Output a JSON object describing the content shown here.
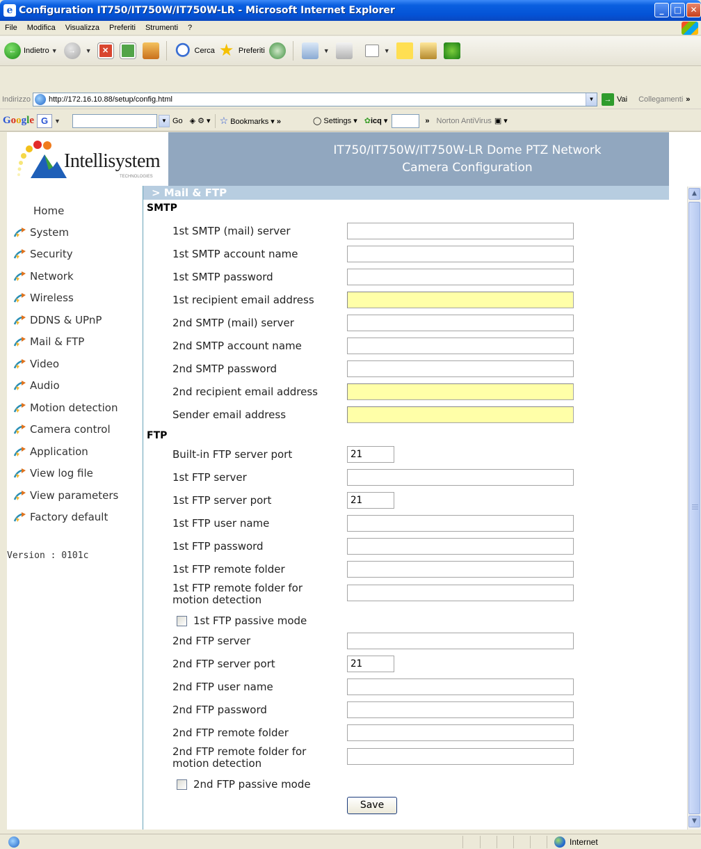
{
  "window": {
    "title": "Configuration IT750/IT750W/IT750W-LR - Microsoft Internet Explorer"
  },
  "menu": {
    "items": [
      "File",
      "Modifica",
      "Visualizza",
      "Preferiti",
      "Strumenti",
      "?"
    ]
  },
  "toolbar": {
    "back_label": "Indietro",
    "search_label": "Cerca",
    "favorites_label": "Preferiti"
  },
  "address": {
    "label": "Indirizzo",
    "url": "http://172.16.10.88/setup/config.html",
    "go_label": "Vai",
    "links_label": "Collegamenti"
  },
  "googlebar": {
    "go_label": "Go",
    "bookmarks_label": "Bookmarks",
    "settings_label": "Settings",
    "icq_label": "icq",
    "norton_label": "Norton AntiVirus"
  },
  "page": {
    "logo_text": "Intellisystem",
    "logo_sub": "TECHNOLOGIES",
    "header_line1": "IT750/IT750W/IT750W-LR Dome PTZ Network",
    "header_line2": "Camera Configuration",
    "section_title": "> Mail & FTP",
    "version": "Version : 0101c"
  },
  "nav": {
    "home": "Home",
    "items": [
      "System",
      "Security",
      "Network",
      "Wireless",
      "DDNS & UPnP",
      "Mail & FTP",
      "Video",
      "Audio",
      "Motion detection",
      "Camera control",
      "Application",
      "View log file",
      "View parameters",
      "Factory default"
    ]
  },
  "form": {
    "smtp_heading": "SMTP",
    "ftp_heading": "FTP",
    "smtp": [
      {
        "label": "1st SMTP (mail) server",
        "value": ""
      },
      {
        "label": "1st SMTP account name",
        "value": ""
      },
      {
        "label": "1st SMTP password",
        "value": ""
      },
      {
        "label": "1st recipient email address",
        "value": ""
      },
      {
        "label": "2nd SMTP (mail) server",
        "value": ""
      },
      {
        "label": "2nd SMTP account name",
        "value": ""
      },
      {
        "label": "2nd SMTP password",
        "value": ""
      },
      {
        "label": "2nd recipient email address",
        "value": ""
      },
      {
        "label": "Sender email address",
        "value": ""
      }
    ],
    "ftp": {
      "builtin_port_label": "Built-in FTP server port",
      "builtin_port_value": "21",
      "ftp1_server_label": "1st FTP server",
      "ftp1_port_label": "1st FTP server port",
      "ftp1_port_value": "21",
      "ftp1_user_label": "1st FTP user name",
      "ftp1_password_label": "1st FTP password",
      "ftp1_folder_label": "1st FTP remote folder",
      "ftp1_motion_label_1": "1st FTP remote folder for",
      "ftp1_motion_label_2": "motion detection",
      "ftp1_passive_label": "1st FTP passive mode",
      "ftp2_server_label": "2nd FTP server",
      "ftp2_port_label": "2nd FTP server port",
      "ftp2_port_value": "21",
      "ftp2_user_label": "2nd FTP user name",
      "ftp2_password_label": "2nd FTP password",
      "ftp2_folder_label": "2nd FTP remote folder",
      "ftp2_motion_label_1": "2nd FTP remote folder for",
      "ftp2_motion_label_2": "motion detection",
      "ftp2_passive_label": "2nd FTP passive mode"
    },
    "save_label": "Save"
  },
  "status": {
    "zone": "Internet"
  },
  "colors": {
    "header_band": "#91a7bf",
    "section_bar": "#b7cde0",
    "required_field": "#ffffa8",
    "nav_border": "#68a2b8"
  }
}
